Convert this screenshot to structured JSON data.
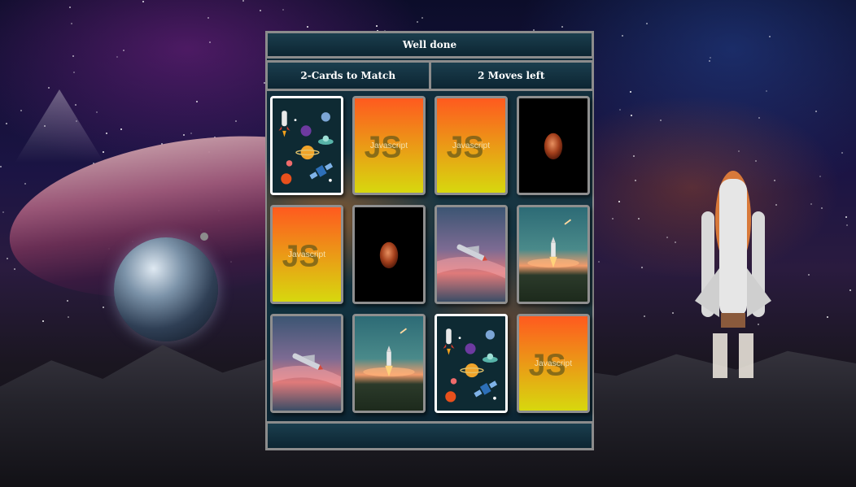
{
  "header": {
    "message": "Well done"
  },
  "info": {
    "match_rule": "2-Cards to Match",
    "moves_left": "2 Moves left"
  },
  "footer": {
    "text": ""
  },
  "colors": {
    "js_card_top": "#ff5a1f",
    "js_card_bottom": "#d7d80e",
    "panel_bar": "#0c2532",
    "card_border": "#8f8f8f",
    "flipped_border": "#ffffff"
  },
  "cards": [
    {
      "face": "space-icons",
      "state": "flipped"
    },
    {
      "face": "javascript",
      "label": "Javascript",
      "mono": "JS",
      "state": "hidden"
    },
    {
      "face": "javascript",
      "label": "Javascript",
      "mono": "JS",
      "state": "hidden"
    },
    {
      "face": "red-moon",
      "state": "matched"
    },
    {
      "face": "javascript",
      "label": "Javascript",
      "mono": "JS",
      "state": "hidden"
    },
    {
      "face": "red-moon",
      "state": "matched"
    },
    {
      "face": "shuttle-sunset",
      "state": "matched"
    },
    {
      "face": "rocket-launch",
      "state": "matched"
    },
    {
      "face": "shuttle-sunset",
      "state": "matched"
    },
    {
      "face": "rocket-launch",
      "state": "matched"
    },
    {
      "face": "space-icons",
      "state": "flipped"
    },
    {
      "face": "javascript",
      "label": "Javascript",
      "mono": "JS",
      "state": "hidden"
    }
  ]
}
